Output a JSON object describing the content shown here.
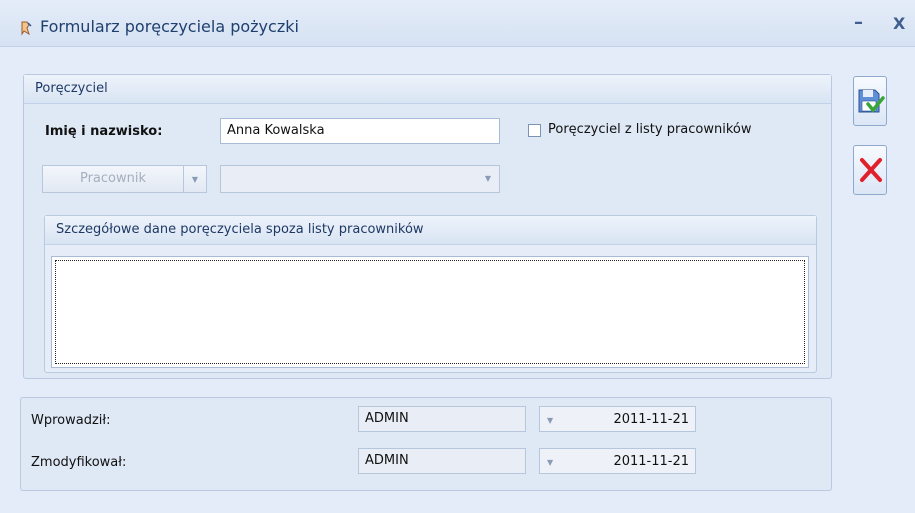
{
  "window": {
    "title": "Formularz poręczyciela pożyczki",
    "minimize_glyph": "–",
    "close_glyph": "X"
  },
  "guarantor_group": {
    "title": "Poręczyciel",
    "name_label": "Imię i nazwisko:",
    "name_value": "Anna Kowalska",
    "from_employees_label": "Poręczyciel z listy pracowników",
    "from_employees_checked": false,
    "employee_button_label": "Pracownik",
    "employee_select_value": ""
  },
  "details_group": {
    "title": "Szczegółowe dane poręczyciela spoza listy pracowników",
    "memo_value": ""
  },
  "audit": {
    "entered_label": "Wprowadził:",
    "entered_user": "ADMIN",
    "entered_date": "2011-11-21",
    "modified_label": "Zmodyfikował:",
    "modified_user": "ADMIN",
    "modified_date": "2011-11-21"
  },
  "icons": {
    "title_icon": "app-form-icon",
    "save_icon": "save-check-icon",
    "cancel_icon": "red-x-icon",
    "dropdown_icon": "chevron-down-icon"
  },
  "colors": {
    "accent": "#1f3f6f",
    "panel_bg": "#e3ecf8",
    "cancel_red": "#e0202a",
    "save_green": "#3aa63a"
  }
}
